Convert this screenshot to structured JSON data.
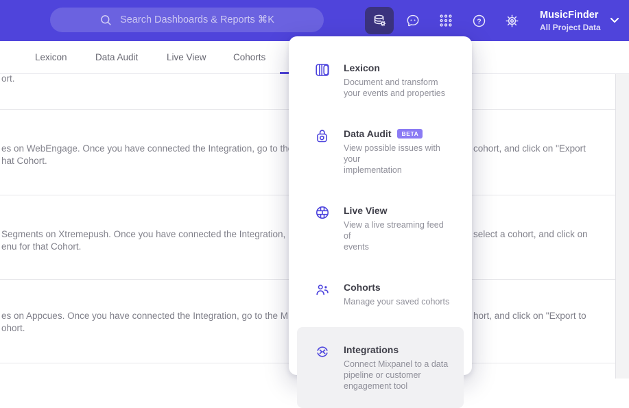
{
  "colors": {
    "topbar": "#4f44db",
    "accent": "#4f44db",
    "active_icon_bg": "#3b337e",
    "beta_badge": "#8b7bf4",
    "menu_icon": "#4c43dd"
  },
  "topbar": {
    "search": {
      "placeholder": "Search Dashboards & Reports ⌘K"
    },
    "actions": [
      {
        "icon": "database-gear-icon",
        "active": true
      },
      {
        "icon": "feedback-chat-icon",
        "active": false
      },
      {
        "icon": "apps-grid-icon",
        "active": false
      },
      {
        "icon": "help-icon",
        "active": false
      },
      {
        "icon": "settings-gear-icon",
        "active": false
      }
    ],
    "project": {
      "name": "MusicFinder",
      "scope": "All Project Data"
    }
  },
  "tabs": [
    {
      "label": "Lexicon"
    },
    {
      "label": "Data Audit"
    },
    {
      "label": "Live View"
    },
    {
      "label": "Cohorts"
    }
  ],
  "menu": {
    "items": [
      {
        "title": "Lexicon",
        "icon": "lexicon-book-icon",
        "description": "Document and transform\nyour events and properties"
      },
      {
        "title": "Data Audit",
        "icon": "data-audit-lock-icon",
        "badge": "BETA",
        "description": "View possible issues with your\nimplementation"
      },
      {
        "title": "Live View",
        "icon": "live-view-globe-icon",
        "description": "View a live streaming feed of\nevents"
      },
      {
        "title": "Cohorts",
        "icon": "cohorts-people-icon",
        "description": "Manage your saved cohorts"
      },
      {
        "title": "Integrations",
        "icon": "integrations-sync-icon",
        "description": "Connect Mixpanel to a data\npipeline or customer\nengagement tool"
      }
    ]
  },
  "background": {
    "rows": [
      {
        "left2": "ort."
      },
      {
        "left1": "es on WebEngage. Once you have connected the Integration, go to the",
        "right1": "cohort, and click on \"Export",
        "left2": "hat Cohort."
      },
      {
        "left1": "Segments on Xtremepush. Once you have connected the Integration,",
        "right1": "select a cohort, and click on",
        "left2": "enu for that Cohort."
      },
      {
        "left1": "es on Appcues. Once you have connected the Integration, go to the M",
        "right1": "hort, and click on \"Export to",
        "left2": "ohort."
      }
    ]
  }
}
